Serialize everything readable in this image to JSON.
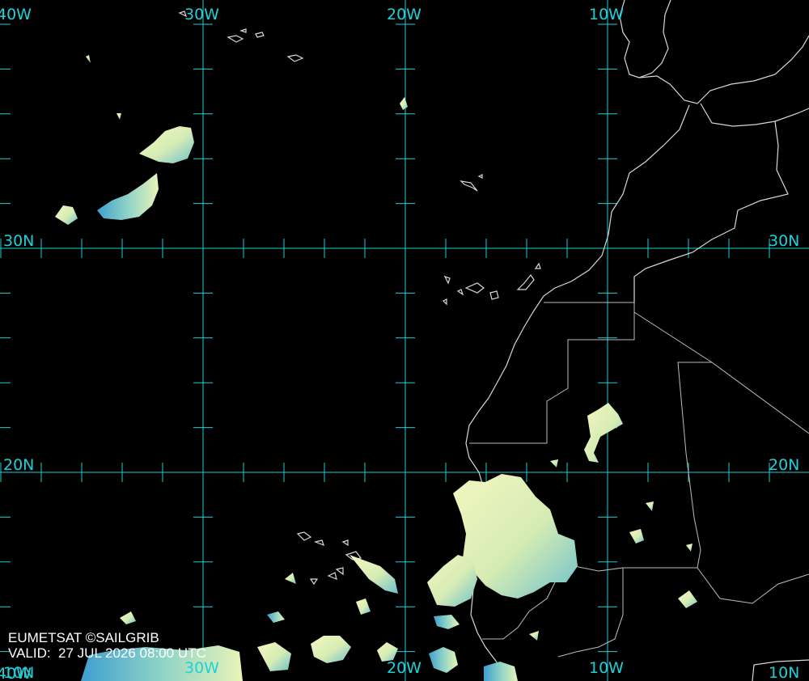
{
  "map": {
    "source": "EUMETSAT ©SAILGRIB",
    "valid_prefix": "VALID:",
    "valid_time": "27 JUL 2026 08:00 UTC",
    "valid_line": "VALID:  27 JUL 2026 08:00 UTC",
    "gridline_color": "#20d0d8",
    "coast_color": "#d8d8d8",
    "cloud_colors": [
      "#f3f7c0",
      "#dcefb5",
      "#8fd3c6",
      "#3f9fd0"
    ],
    "longitudes": {
      "lon_40w": "40W",
      "lon_30w": "30W",
      "lon_20w": "20W",
      "lon_10w": "10W"
    },
    "latitudes": {
      "lat_30n": "30N",
      "lat_20n": "20N",
      "lat_10n": "10N"
    }
  }
}
